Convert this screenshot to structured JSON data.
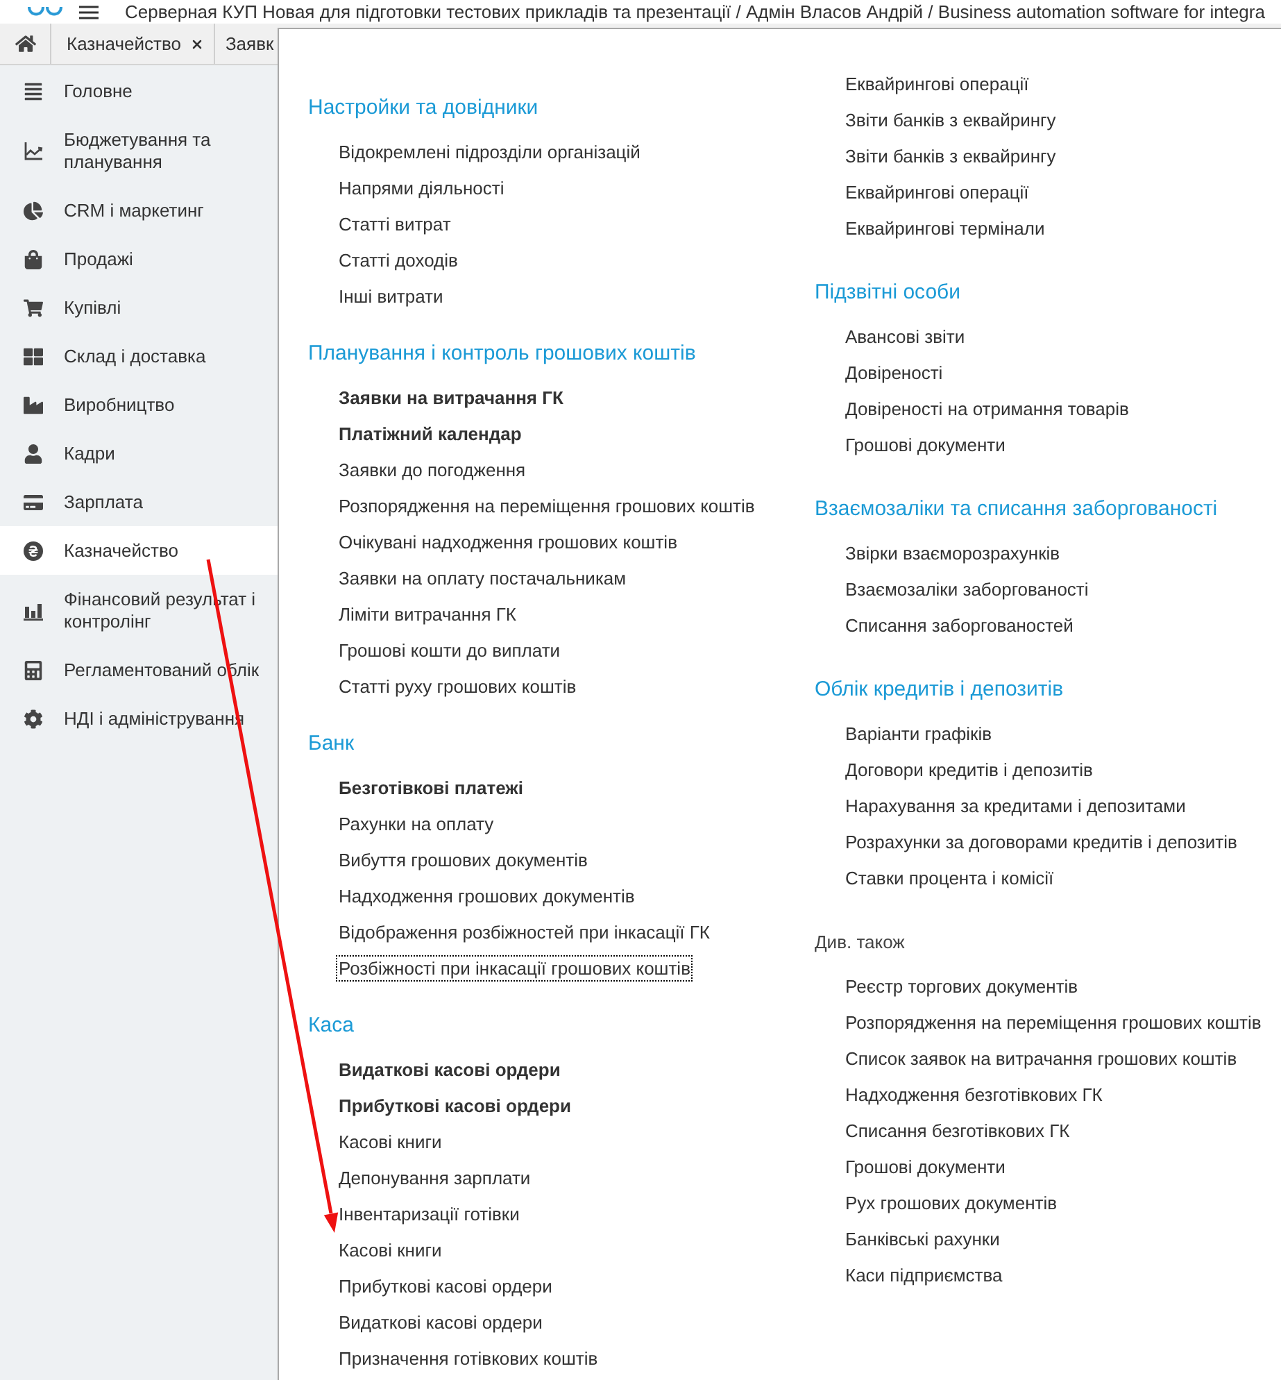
{
  "window": {
    "title": "Серверная КУП Новая для підготовки тестових прикладів та презентації / Адмін Власов Андрій / Business automation software for integra"
  },
  "tabs": [
    {
      "label": "Казначейство",
      "closable": true
    },
    {
      "label": "Заявк",
      "closable": false
    }
  ],
  "sidebar": {
    "items": [
      {
        "label": "Головне",
        "selected": false
      },
      {
        "label": "Бюджетування та планування",
        "selected": false
      },
      {
        "label": "CRM і маркетинг",
        "selected": false
      },
      {
        "label": "Продажі",
        "selected": false
      },
      {
        "label": "Купівлі",
        "selected": false
      },
      {
        "label": "Склад і доставка",
        "selected": false
      },
      {
        "label": "Виробництво",
        "selected": false
      },
      {
        "label": "Кадри",
        "selected": false
      },
      {
        "label": "Зарплата",
        "selected": false
      },
      {
        "label": "Казначейство",
        "selected": true
      },
      {
        "label": "Фінансовий результат і контролінг",
        "selected": false
      },
      {
        "label": "Регламентований облік",
        "selected": false
      },
      {
        "label": "НДІ і адміністрування",
        "selected": false
      }
    ]
  },
  "panel": {
    "columns": [
      {
        "sections": [
          {
            "kind": "group",
            "title": "Настройки та довідники",
            "items": [
              {
                "label": "Відокремлені підрозділи організацій",
                "bold": false,
                "focused": false
              },
              {
                "label": "Напрями діяльності",
                "bold": false,
                "focused": false
              },
              {
                "label": "Статті витрат",
                "bold": false,
                "focused": false
              },
              {
                "label": "Статті доходів",
                "bold": false,
                "focused": false
              },
              {
                "label": "Інші витрати",
                "bold": false,
                "focused": false
              }
            ]
          },
          {
            "kind": "group",
            "title": "Планування і контроль грошових коштів",
            "items": [
              {
                "label": "Заявки на витрачання ГК",
                "bold": true,
                "focused": false
              },
              {
                "label": "Платіжний календар",
                "bold": true,
                "focused": false
              },
              {
                "label": "Заявки до погодження",
                "bold": false,
                "focused": false
              },
              {
                "label": "Розпорядження на переміщення грошових коштів",
                "bold": false,
                "focused": false
              },
              {
                "label": "Очікувані надходження грошових коштів",
                "bold": false,
                "focused": false
              },
              {
                "label": "Заявки на оплату постачальникам",
                "bold": false,
                "focused": false
              },
              {
                "label": "Ліміти витрачання ГК",
                "bold": false,
                "focused": false
              },
              {
                "label": "Грошові кошти до виплати",
                "bold": false,
                "focused": false
              },
              {
                "label": "Статті руху грошових коштів",
                "bold": false,
                "focused": false
              }
            ]
          },
          {
            "kind": "group",
            "title": "Банк",
            "items": [
              {
                "label": "Безготівкові платежі",
                "bold": true,
                "focused": false
              },
              {
                "label": "Рахунки на оплату",
                "bold": false,
                "focused": false
              },
              {
                "label": "Вибуття грошових документів",
                "bold": false,
                "focused": false
              },
              {
                "label": "Надходження грошових документів",
                "bold": false,
                "focused": false
              },
              {
                "label": "Відображення розбіжностей при інкасації ГК",
                "bold": false,
                "focused": false
              },
              {
                "label": "Розбіжності при інкасації грошових коштів",
                "bold": false,
                "focused": true
              }
            ]
          },
          {
            "kind": "group",
            "title": "Каса",
            "items": [
              {
                "label": "Видаткові касові ордери",
                "bold": true,
                "focused": false
              },
              {
                "label": "Прибуткові касові ордери",
                "bold": true,
                "focused": false
              },
              {
                "label": "Касові книги",
                "bold": false,
                "focused": false
              },
              {
                "label": "Депонування зарплати",
                "bold": false,
                "focused": false
              },
              {
                "label": "Інвентаризації готівки",
                "bold": false,
                "focused": false
              },
              {
                "label": "Касові книги",
                "bold": false,
                "focused": false
              },
              {
                "label": "Прибуткові касові ордери",
                "bold": false,
                "focused": false
              },
              {
                "label": "Видаткові касові ордери",
                "bold": false,
                "focused": false
              },
              {
                "label": "Призначення готівкових коштів",
                "bold": false,
                "focused": false
              }
            ]
          }
        ]
      },
      {
        "sections": [
          {
            "kind": "group",
            "items": [
              {
                "label": "Еквайрингові операції",
                "bold": false,
                "focused": false
              },
              {
                "label": "Звіти банків з еквайрингу",
                "bold": false,
                "focused": false
              },
              {
                "label": "Звіти банків з еквайрингу",
                "bold": false,
                "focused": false
              },
              {
                "label": "Еквайрингові операції",
                "bold": false,
                "focused": false
              },
              {
                "label": "Еквайрингові термінали",
                "bold": false,
                "focused": false
              }
            ]
          },
          {
            "kind": "group",
            "title": "Підзвітні особи",
            "items": [
              {
                "label": "Авансові звіти",
                "bold": false,
                "focused": false
              },
              {
                "label": "Довіреності",
                "bold": false,
                "focused": false
              },
              {
                "label": "Довіреності на отримання товарів",
                "bold": false,
                "focused": false
              },
              {
                "label": "Грошові документи",
                "bold": false,
                "focused": false
              }
            ]
          },
          {
            "kind": "group",
            "title": "Взаємозаліки та списання заборгованості",
            "items": [
              {
                "label": "Звірки взаєморозрахунків",
                "bold": false,
                "focused": false
              },
              {
                "label": "Взаємозаліки заборгованості",
                "bold": false,
                "focused": false
              },
              {
                "label": "Списання заборгованостей",
                "bold": false,
                "focused": false
              }
            ]
          },
          {
            "kind": "group",
            "title": "Облік кредитів і депозитів",
            "items": [
              {
                "label": "Варіанти графіків",
                "bold": false,
                "focused": false
              },
              {
                "label": "Договори кредитів і депозитів",
                "bold": false,
                "focused": false
              },
              {
                "label": "Нарахування за кредитами і депозитами",
                "bold": false,
                "focused": false
              },
              {
                "label": "Розрахунки за договорами кредитів і депозитів",
                "bold": false,
                "focused": false
              },
              {
                "label": "Ставки процента і комісії",
                "bold": false,
                "focused": false
              }
            ]
          },
          {
            "kind": "see_also",
            "title": "Див. також",
            "items": [
              {
                "label": "Реєстр торгових документів",
                "bold": false,
                "focused": false
              },
              {
                "label": "Розпорядження на переміщення грошових коштів",
                "bold": false,
                "focused": false
              },
              {
                "label": "Список заявок на витрачання грошових коштів",
                "bold": false,
                "focused": false
              },
              {
                "label": "Надходження безготівкових ГК",
                "bold": false,
                "focused": false
              },
              {
                "label": "Списання безготівкових ГК",
                "bold": false,
                "focused": false
              },
              {
                "label": "Грошові документи",
                "bold": false,
                "focused": false
              },
              {
                "label": "Рух грошових документів",
                "bold": false,
                "focused": false
              },
              {
                "label": "Банківські рахунки",
                "bold": false,
                "focused": false
              },
              {
                "label": "Каси підприємства",
                "bold": false,
                "focused": false
              }
            ]
          }
        ]
      }
    ]
  }
}
